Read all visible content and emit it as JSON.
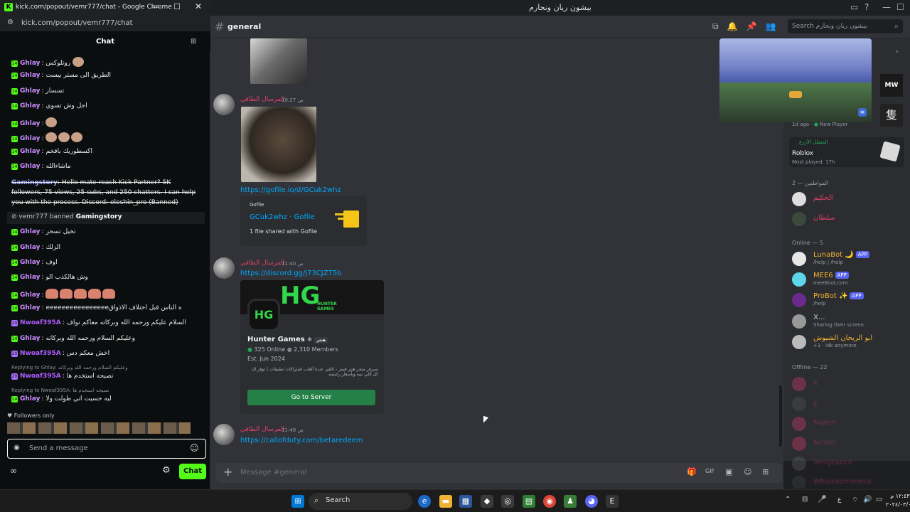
{
  "kick": {
    "window_title": "kick.com/popout/vemr777/chat - Google Chrome",
    "url": "kick.com/popout/vemr777/chat",
    "chat_title": "Chat",
    "messages": [
      {
        "user": "Ghlay",
        "text": "روتلوكس"
      },
      {
        "user": "Ghlay",
        "text": "الطريق الى مستر بيست"
      },
      {
        "user": "Ghlay",
        "text": "تسسار"
      },
      {
        "user": "Ghlay",
        "text": "اجل وش تسوي"
      },
      {
        "user": "Ghlay",
        "text": ""
      },
      {
        "user": "Ghlay",
        "text": ""
      },
      {
        "user": "Ghlay",
        "text": "اكسطوريك بافخم"
      },
      {
        "user": "Ghlay",
        "text": "ماشاءالله"
      }
    ],
    "spam_user": "Gamingstory",
    "spam_text": "Hello mate reach Kick Partner? 5K followers, 75 views, 25 subs, and 250 chatters. I can help you with the process. Discord: eleshin_pro (Banned)",
    "ban_notice": {
      "mod": "vemr777",
      "action": "banned",
      "target": "Gamingstory"
    },
    "messages2": [
      {
        "user": "Ghlay",
        "text": "تخيل تسحر"
      },
      {
        "user": "Ghlay",
        "text": "الزلك"
      },
      {
        "user": "Ghlay",
        "text": "اوف"
      },
      {
        "user": "Ghlay",
        "text": "وش هالكذب الو"
      },
      {
        "user": "Ghlay",
        "text": ""
      },
      {
        "user": "Ghlay",
        "text": "eeeeeeeeeeeeeeeeه الناس قبل اختلاف الاذواق"
      },
      {
        "user": "Nwoaf395A",
        "text": "السلام عليكم ورحمه الله وبركاته معاكم نواف"
      },
      {
        "user": "Ghlay",
        "text": "وعليكم السلام ورحمه الله وبركاته"
      },
      {
        "user": "Nwoaf395A",
        "text": "اخش معكم دس"
      }
    ],
    "reply1": "Replying to Ghlay: وعليكم السلام ورحمه الله وبركاته",
    "reply1_msg": {
      "user": "Nwoaf395A",
      "text": "نصيحه استخدم ها"
    },
    "reply2": "Replying to Nwoaf395A: نصيحه استخدم ها",
    "reply2_msg": {
      "user": "Ghlay",
      "text": "ليه حسيت اني طولت ولا"
    },
    "followers_only": "Followers only",
    "input_placeholder": "Send a message",
    "chat_button": "Chat",
    "infinity": "∞"
  },
  "discord": {
    "window_title": "بيشون ريان ونجارم",
    "channel": "general",
    "search_placeholder": "Search بيشون ريان ونجارم",
    "messages": [
      {
        "user": "المرسال الطافي",
        "time": "10:27 ص",
        "link": "https://gofile.io/d/GCuk2whz",
        "embed": {
          "provider": "Gofile",
          "title": "GCuk2whz · Gofile",
          "desc": "1 file shared with Gofile"
        }
      },
      {
        "user": "المرسال الطافي",
        "time": "11:40 ص",
        "link": "https://discord.gg/j73CJZT5b",
        "invite": {
          "name": "Hunter Games",
          "online": "325 Online",
          "members": "2,310 Members",
          "est": "Est. Jun 2024",
          "desc": "سيرفر متجر هنتر قيمز - نالقي عندنا ألعاب اشتراكات تطبيقات | توفر لك كل اللي تبيه وبأسعار رخيصه",
          "button": "Go to Server",
          "tag": "هنتر"
        }
      },
      {
        "user": "المرسال الطافي",
        "time": "11:48 ص",
        "link": "https://callofduty.com/betaredeem"
      }
    ],
    "composer_placeholder": "Message #general",
    "members": {
      "activity_time": "1d ago",
      "activity_label": "New Player",
      "activity_user": "المتفلل الأزرع",
      "activity_game": "Roblox",
      "activity_played": "Most played: 17h",
      "role_header": "المواطنين — 2",
      "role_members": [
        "الحكيم",
        "سلطان"
      ],
      "online_header": "Online — 5",
      "online": [
        {
          "name": "LunaBot 🌙",
          "badge": "APP",
          "sub": "/help | /help",
          "color": "#f0b232"
        },
        {
          "name": "MEE6",
          "badge": "APP",
          "sub": "mee6bot.com",
          "color": "#f0b232"
        },
        {
          "name": "ProBot ✨",
          "badge": "APP",
          "sub": "/help",
          "color": "#f0b232"
        },
        {
          "name": "X...",
          "badge": "",
          "sub": "Sharing their screen",
          "color": "#c7c7c7"
        },
        {
          "name": "ابو الريحان الشبوش",
          "badge": "",
          "sub": "+1 · idk anymore",
          "color": "#f0b232"
        }
      ],
      "offline_header": "Offline — 22",
      "offline": [
        "x",
        "ع",
        "Najem",
        "Nuviel",
        "Vengeance",
        "Wholesomeness"
      ]
    }
  },
  "taskbar": {
    "search": "Search",
    "time": "١٢:٤٣ م",
    "date": "٢٠٢٤/٠٣/٠٧",
    "lang": "ع"
  }
}
